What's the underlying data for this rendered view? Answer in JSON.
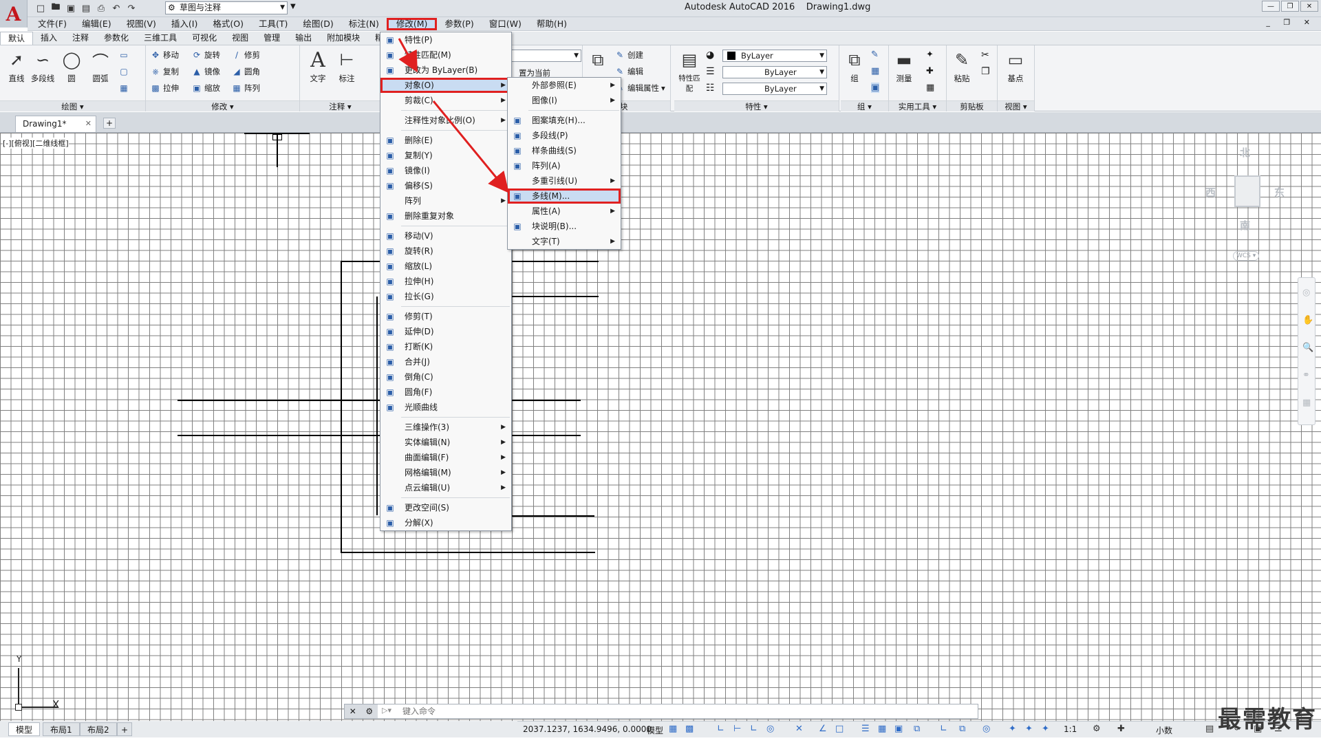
{
  "app": {
    "window_title": "Autodesk AutoCAD 2016    Drawing1.dwg",
    "workspace": "草图与注释"
  },
  "menubar": {
    "items": [
      {
        "label": "文件(F)"
      },
      {
        "label": "编辑(E)"
      },
      {
        "label": "视图(V)"
      },
      {
        "label": "插入(I)"
      },
      {
        "label": "格式(O)"
      },
      {
        "label": "工具(T)"
      },
      {
        "label": "绘图(D)"
      },
      {
        "label": "标注(N)"
      },
      {
        "label": "修改(M)"
      },
      {
        "label": "参数(P)"
      },
      {
        "label": "窗口(W)"
      },
      {
        "label": "帮助(H)"
      }
    ],
    "active": "修改(M)"
  },
  "ribbon_tabs": [
    "默认",
    "插入",
    "注释",
    "参数化",
    "三维工具",
    "可视化",
    "视图",
    "管理",
    "输出",
    "附加模块",
    "精选"
  ],
  "ribbon": {
    "draw": {
      "title": "绘图",
      "line": "直线",
      "polyline": "多段线",
      "circle": "圆",
      "arc": "圆弧"
    },
    "modify": {
      "title": "修改",
      "move": "移动",
      "rotate": "旋转",
      "trim": "修剪",
      "copy": "复制",
      "mirror": "镜像",
      "fillet": "圆角",
      "stretch": "拉伸",
      "scale": "缩放",
      "array": "阵列"
    },
    "annotation": {
      "title": "注释",
      "text": "文字",
      "dimension": "标注"
    },
    "layer_partial": {
      "set_current": "置为当前"
    },
    "block": {
      "title": "块",
      "create": "创建",
      "edit": "编辑",
      "edit_attr": "编辑属性"
    },
    "properties": {
      "title": "特性",
      "match": "特性匹配",
      "color": "ByLayer",
      "linetype": "ByLayer",
      "lineweight": "ByLayer"
    },
    "groups": {
      "title": "组",
      "group": "组"
    },
    "utilities": {
      "title": "实用工具",
      "measure": "测量"
    },
    "clipboard": {
      "title": "剪贴板",
      "paste": "粘贴"
    },
    "view": {
      "title": "视图",
      "base": "基点"
    }
  },
  "doc_tab": {
    "label": "Drawing1*"
  },
  "viewport_label": "[-][俯视][二维线框]",
  "viewcube": {
    "north": "北",
    "south": "南",
    "east": "东",
    "west": "西",
    "wcs": "WCS"
  },
  "ucs": {
    "x": "X",
    "y": "Y"
  },
  "modify_menu": {
    "items": [
      {
        "label": "特性(P)",
        "icon": "properties-icon"
      },
      {
        "label": "特性匹配(M)",
        "icon": "match-properties-icon"
      },
      {
        "label": "更改为 ByLayer(B)",
        "icon": "bylayer-icon"
      },
      {
        "label": "对象(O)",
        "icon": "",
        "submenu": true,
        "highlight": true
      },
      {
        "label": "剪裁(C)",
        "icon": "",
        "submenu": true
      },
      {
        "sep": true
      },
      {
        "label": "注释性对象比例(O)",
        "icon": "",
        "submenu": true
      },
      {
        "sep": true
      },
      {
        "label": "删除(E)",
        "icon": "erase-icon"
      },
      {
        "label": "复制(Y)",
        "icon": "copy-icon"
      },
      {
        "label": "镜像(I)",
        "icon": "mirror-icon"
      },
      {
        "label": "偏移(S)",
        "icon": "offset-icon"
      },
      {
        "label": "阵列",
        "icon": "",
        "submenu": true
      },
      {
        "label": "删除重复对象",
        "icon": "overkill-icon"
      },
      {
        "sep": true
      },
      {
        "label": "移动(V)",
        "icon": "move-icon"
      },
      {
        "label": "旋转(R)",
        "icon": "rotate-icon"
      },
      {
        "label": "缩放(L)",
        "icon": "scale-icon"
      },
      {
        "label": "拉伸(H)",
        "icon": "stretch-icon"
      },
      {
        "label": "拉长(G)",
        "icon": "lengthen-icon"
      },
      {
        "sep": true
      },
      {
        "label": "修剪(T)",
        "icon": "trim-icon"
      },
      {
        "label": "延伸(D)",
        "icon": "extend-icon"
      },
      {
        "label": "打断(K)",
        "icon": "break-icon"
      },
      {
        "label": "合并(J)",
        "icon": "join-icon"
      },
      {
        "label": "倒角(C)",
        "icon": "chamfer-icon"
      },
      {
        "label": "圆角(F)",
        "icon": "fillet-icon"
      },
      {
        "label": "光顺曲线",
        "icon": "blend-icon"
      },
      {
        "sep": true
      },
      {
        "label": "三维操作(3)",
        "icon": "",
        "submenu": true
      },
      {
        "label": "实体编辑(N)",
        "icon": "",
        "submenu": true
      },
      {
        "label": "曲面编辑(F)",
        "icon": "",
        "submenu": true
      },
      {
        "label": "网格编辑(M)",
        "icon": "",
        "submenu": true
      },
      {
        "label": "点云编辑(U)",
        "icon": "",
        "submenu": true
      },
      {
        "sep": true
      },
      {
        "label": "更改空间(S)",
        "icon": "change-space-icon"
      },
      {
        "label": "分解(X)",
        "icon": "explode-icon"
      }
    ]
  },
  "object_menu": {
    "items": [
      {
        "label": "外部参照(E)",
        "icon": "",
        "submenu": true
      },
      {
        "label": "图像(I)",
        "icon": "",
        "submenu": true
      },
      {
        "sep": true
      },
      {
        "label": "图案填充(H)...",
        "icon": "hatch-edit-icon"
      },
      {
        "label": "多段线(P)",
        "icon": "pedit-icon"
      },
      {
        "label": "样条曲线(S)",
        "icon": "spline-edit-icon"
      },
      {
        "label": "阵列(A)",
        "icon": "array-edit-icon"
      },
      {
        "label": "多重引线(U)",
        "icon": "",
        "submenu": true
      },
      {
        "label": "多线(M)...",
        "icon": "mline-edit-icon",
        "highlight": true
      },
      {
        "label": "属性(A)",
        "icon": "",
        "submenu": true
      },
      {
        "label": "块说明(B)...",
        "icon": "block-description-icon"
      },
      {
        "label": "文字(T)",
        "icon": "",
        "submenu": true
      }
    ]
  },
  "command_line": {
    "placeholder": "键入命令"
  },
  "layout_tabs": [
    {
      "label": "模型",
      "active": true
    },
    {
      "label": "布局1"
    },
    {
      "label": "布局2"
    }
  ],
  "status": {
    "coords": "2037.1237, 1634.9496, 0.0000",
    "model": "模型",
    "scale": "1:1",
    "units": "小数"
  },
  "watermark": "最需教育",
  "colors": {
    "highlight_border": "#e02020",
    "menu_highlight": "#c9dcf2",
    "brand": "#c4161c"
  }
}
